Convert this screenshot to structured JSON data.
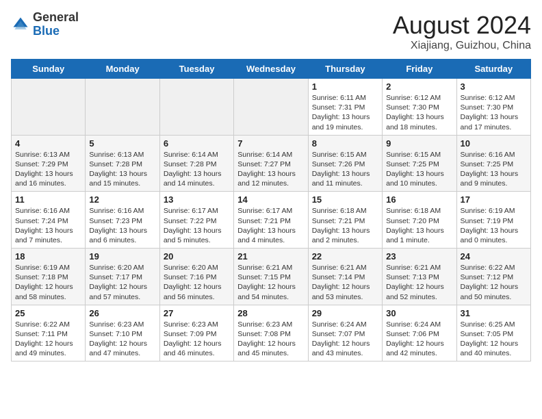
{
  "header": {
    "logo_general": "General",
    "logo_blue": "Blue",
    "main_title": "August 2024",
    "subtitle": "Xiajiang, Guizhou, China"
  },
  "days_of_week": [
    "Sunday",
    "Monday",
    "Tuesday",
    "Wednesday",
    "Thursday",
    "Friday",
    "Saturday"
  ],
  "weeks": [
    [
      {
        "day": "",
        "text": ""
      },
      {
        "day": "",
        "text": ""
      },
      {
        "day": "",
        "text": ""
      },
      {
        "day": "",
        "text": ""
      },
      {
        "day": "1",
        "text": "Sunrise: 6:11 AM\nSunset: 7:31 PM\nDaylight: 13 hours\nand 19 minutes."
      },
      {
        "day": "2",
        "text": "Sunrise: 6:12 AM\nSunset: 7:30 PM\nDaylight: 13 hours\nand 18 minutes."
      },
      {
        "day": "3",
        "text": "Sunrise: 6:12 AM\nSunset: 7:30 PM\nDaylight: 13 hours\nand 17 minutes."
      }
    ],
    [
      {
        "day": "4",
        "text": "Sunrise: 6:13 AM\nSunset: 7:29 PM\nDaylight: 13 hours\nand 16 minutes."
      },
      {
        "day": "5",
        "text": "Sunrise: 6:13 AM\nSunset: 7:28 PM\nDaylight: 13 hours\nand 15 minutes."
      },
      {
        "day": "6",
        "text": "Sunrise: 6:14 AM\nSunset: 7:28 PM\nDaylight: 13 hours\nand 14 minutes."
      },
      {
        "day": "7",
        "text": "Sunrise: 6:14 AM\nSunset: 7:27 PM\nDaylight: 13 hours\nand 12 minutes."
      },
      {
        "day": "8",
        "text": "Sunrise: 6:15 AM\nSunset: 7:26 PM\nDaylight: 13 hours\nand 11 minutes."
      },
      {
        "day": "9",
        "text": "Sunrise: 6:15 AM\nSunset: 7:25 PM\nDaylight: 13 hours\nand 10 minutes."
      },
      {
        "day": "10",
        "text": "Sunrise: 6:16 AM\nSunset: 7:25 PM\nDaylight: 13 hours\nand 9 minutes."
      }
    ],
    [
      {
        "day": "11",
        "text": "Sunrise: 6:16 AM\nSunset: 7:24 PM\nDaylight: 13 hours\nand 7 minutes."
      },
      {
        "day": "12",
        "text": "Sunrise: 6:16 AM\nSunset: 7:23 PM\nDaylight: 13 hours\nand 6 minutes."
      },
      {
        "day": "13",
        "text": "Sunrise: 6:17 AM\nSunset: 7:22 PM\nDaylight: 13 hours\nand 5 minutes."
      },
      {
        "day": "14",
        "text": "Sunrise: 6:17 AM\nSunset: 7:21 PM\nDaylight: 13 hours\nand 4 minutes."
      },
      {
        "day": "15",
        "text": "Sunrise: 6:18 AM\nSunset: 7:21 PM\nDaylight: 13 hours\nand 2 minutes."
      },
      {
        "day": "16",
        "text": "Sunrise: 6:18 AM\nSunset: 7:20 PM\nDaylight: 13 hours\nand 1 minute."
      },
      {
        "day": "17",
        "text": "Sunrise: 6:19 AM\nSunset: 7:19 PM\nDaylight: 13 hours\nand 0 minutes."
      }
    ],
    [
      {
        "day": "18",
        "text": "Sunrise: 6:19 AM\nSunset: 7:18 PM\nDaylight: 12 hours\nand 58 minutes."
      },
      {
        "day": "19",
        "text": "Sunrise: 6:20 AM\nSunset: 7:17 PM\nDaylight: 12 hours\nand 57 minutes."
      },
      {
        "day": "20",
        "text": "Sunrise: 6:20 AM\nSunset: 7:16 PM\nDaylight: 12 hours\nand 56 minutes."
      },
      {
        "day": "21",
        "text": "Sunrise: 6:21 AM\nSunset: 7:15 PM\nDaylight: 12 hours\nand 54 minutes."
      },
      {
        "day": "22",
        "text": "Sunrise: 6:21 AM\nSunset: 7:14 PM\nDaylight: 12 hours\nand 53 minutes."
      },
      {
        "day": "23",
        "text": "Sunrise: 6:21 AM\nSunset: 7:13 PM\nDaylight: 12 hours\nand 52 minutes."
      },
      {
        "day": "24",
        "text": "Sunrise: 6:22 AM\nSunset: 7:12 PM\nDaylight: 12 hours\nand 50 minutes."
      }
    ],
    [
      {
        "day": "25",
        "text": "Sunrise: 6:22 AM\nSunset: 7:11 PM\nDaylight: 12 hours\nand 49 minutes."
      },
      {
        "day": "26",
        "text": "Sunrise: 6:23 AM\nSunset: 7:10 PM\nDaylight: 12 hours\nand 47 minutes."
      },
      {
        "day": "27",
        "text": "Sunrise: 6:23 AM\nSunset: 7:09 PM\nDaylight: 12 hours\nand 46 minutes."
      },
      {
        "day": "28",
        "text": "Sunrise: 6:23 AM\nSunset: 7:08 PM\nDaylight: 12 hours\nand 45 minutes."
      },
      {
        "day": "29",
        "text": "Sunrise: 6:24 AM\nSunset: 7:07 PM\nDaylight: 12 hours\nand 43 minutes."
      },
      {
        "day": "30",
        "text": "Sunrise: 6:24 AM\nSunset: 7:06 PM\nDaylight: 12 hours\nand 42 minutes."
      },
      {
        "day": "31",
        "text": "Sunrise: 6:25 AM\nSunset: 7:05 PM\nDaylight: 12 hours\nand 40 minutes."
      }
    ]
  ]
}
